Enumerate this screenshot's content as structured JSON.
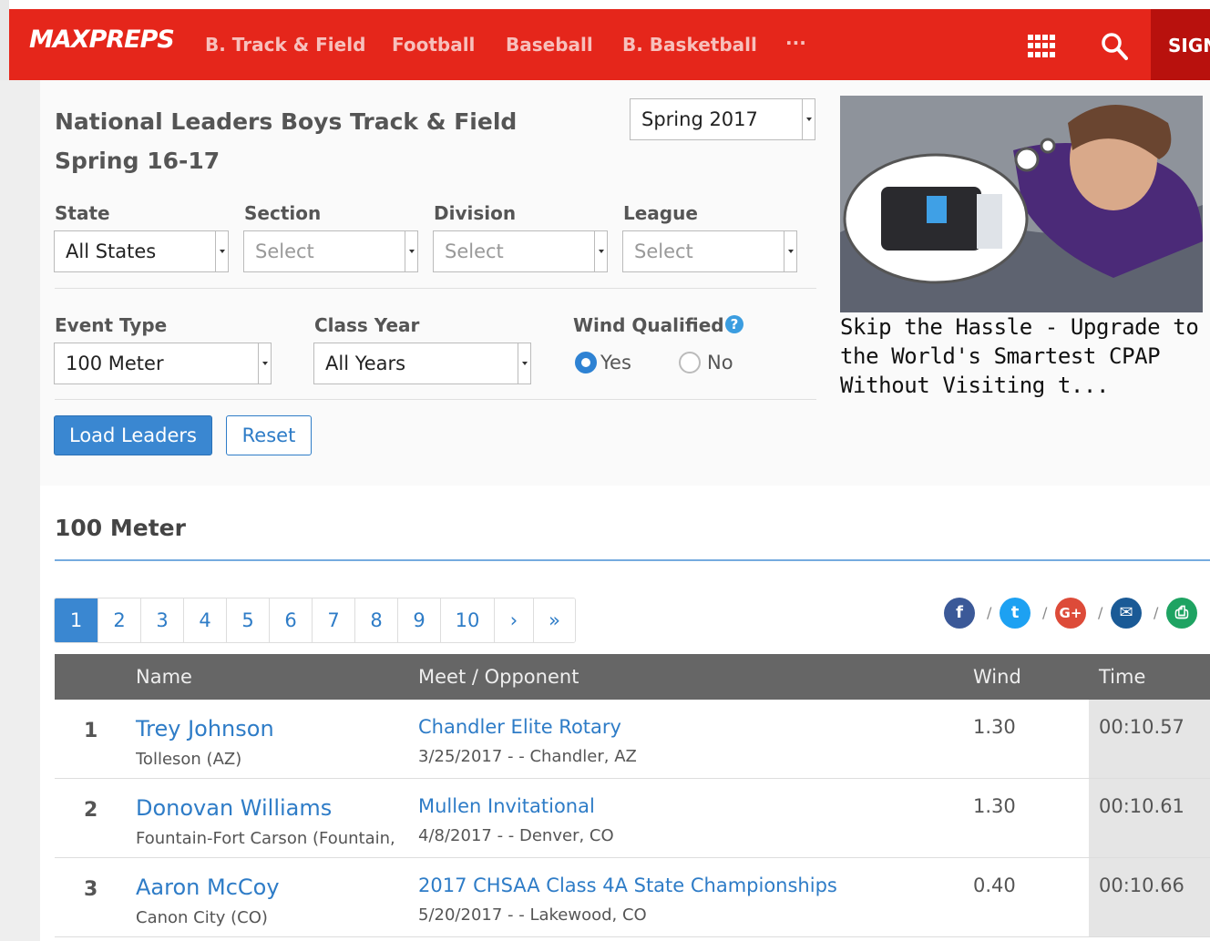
{
  "nav": {
    "logo": "MAXPREPS",
    "links": [
      "B. Track & Field",
      "Football",
      "Baseball",
      "B. Basketball"
    ],
    "more": "···",
    "sign": "SIGN"
  },
  "page": {
    "title": "National Leaders Boys Track & Field Spring 16-17",
    "season_select": "Spring 2017"
  },
  "filters": {
    "state": {
      "label": "State",
      "value": "All States"
    },
    "section": {
      "label": "Section",
      "value": "Select"
    },
    "division": {
      "label": "Division",
      "value": "Select"
    },
    "league": {
      "label": "League",
      "value": "Select"
    },
    "event_type": {
      "label": "Event Type",
      "value": "100 Meter"
    },
    "class_year": {
      "label": "Class Year",
      "value": "All Years"
    },
    "wind": {
      "label": "Wind Qualified",
      "help": "?",
      "yes": "Yes",
      "no": "No",
      "selected": "Yes"
    }
  },
  "buttons": {
    "load": "Load Leaders",
    "reset": "Reset"
  },
  "ad": {
    "caption": "Skip the Hassle - Upgrade to the World's Smartest CPAP Without Visiting t..."
  },
  "results": {
    "title": "100 Meter",
    "pages": [
      "1",
      "2",
      "3",
      "4",
      "5",
      "6",
      "7",
      "8",
      "9",
      "10",
      "›",
      "»"
    ],
    "share": [
      "f",
      "t",
      "G+",
      "✉",
      "⎙"
    ],
    "share_colors": [
      "#3b5998",
      "#1da1f2",
      "#dd4b39",
      "#1a5a96",
      "#1ea362"
    ],
    "columns": {
      "name": "Name",
      "meet": "Meet / Opponent",
      "wind": "Wind",
      "time": "Time"
    },
    "rows": [
      {
        "rank": "1",
        "name": "Trey Johnson",
        "school": "Tolleson (AZ)",
        "meet": "Chandler Elite Rotary",
        "meet_info": "3/25/2017 - - Chandler, AZ",
        "wind": "1.30",
        "time": "00:10.57"
      },
      {
        "rank": "2",
        "name": "Donovan Williams",
        "school": "Fountain-Fort Carson (Fountain,",
        "meet": "Mullen Invitational",
        "meet_info": "4/8/2017 - - Denver, CO",
        "wind": "1.30",
        "time": "00:10.61"
      },
      {
        "rank": "3",
        "name": "Aaron McCoy",
        "school": "Canon City (CO)",
        "meet": "2017 CHSAA Class 4A State Championships",
        "meet_info": "5/20/2017 - - Lakewood, CO",
        "wind": "0.40",
        "time": "00:10.66"
      }
    ]
  }
}
